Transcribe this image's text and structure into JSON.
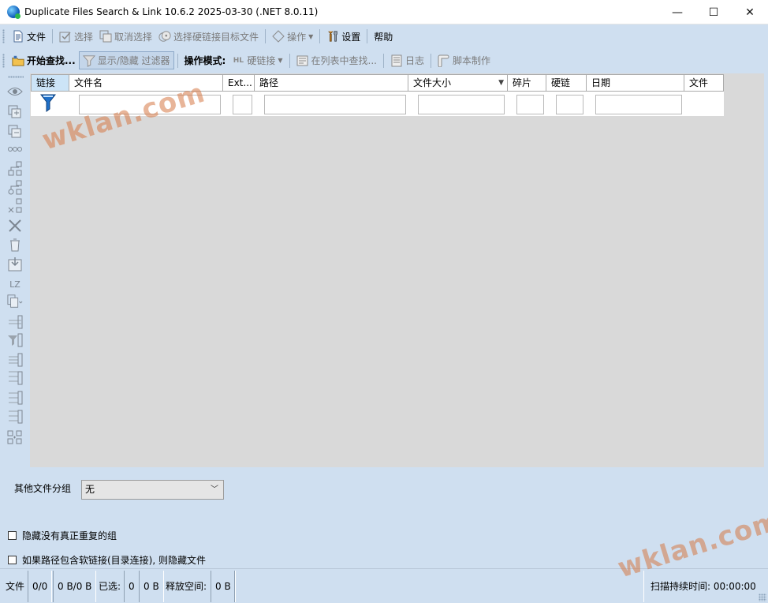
{
  "window": {
    "title": "Duplicate Files Search & Link 10.6.2 2025-03-30 (.NET 8.0.11)",
    "minimize": "—",
    "maximize": "☐",
    "close": "✕"
  },
  "menu_toolbar": {
    "file": "文件",
    "select": "选择",
    "deselect": "取消选择",
    "select_hardlink_target": "选择硬链接目标文件",
    "operations": "操作",
    "settings": "设置",
    "help": "帮助"
  },
  "action_toolbar": {
    "start_search": "开始查找...",
    "toggle_filter": "显示/隐藏 过滤器",
    "mode_label": "操作模式:",
    "hardlink": "硬链接",
    "find_in_list": "在列表中查找...",
    "log": "日志",
    "script": "脚本制作"
  },
  "grid": {
    "columns": [
      "链接",
      "文件名",
      "Ext...",
      "路径",
      "文件大小",
      "碎片",
      "硬链",
      "日期",
      "文件"
    ],
    "sorted_column": "文件大小",
    "selected_column": "链接"
  },
  "options": {
    "group_label": "其他文件分组",
    "group_value": "无",
    "hide_groups": "隐藏没有真正重复的组",
    "hide_softlink": "如果路径包含软链接(目录连接), 则隐藏文件"
  },
  "status": {
    "files_label": "文件",
    "files_count": "0/0",
    "files_size": "0 B/0 B",
    "selected_label": "已选:",
    "selected_count": "0",
    "selected_size": "0 B",
    "free_label": "释放空间:",
    "free_value": "0 B",
    "scan_time_label": "扫描持续时间:",
    "scan_time": "00:00:00"
  },
  "watermarks": [
    "wklan.com",
    "wklan.com"
  ],
  "colors": {
    "background": "#cfdff0",
    "grid_bg": "#d9d9d9",
    "selected_header": "#cce4f7",
    "filter_icon": "#1e6fc8"
  },
  "icons": {
    "side": [
      "eye-icon",
      "add-group-icon",
      "remove-group-icon",
      "link-icon",
      "select-tree-icon",
      "select-tree-2-icon",
      "select-tree-3-icon",
      "delete-icon",
      "recycle-icon",
      "move-icon",
      "lz-icon",
      "copy-icon",
      "bar-1-icon",
      "filter-bar-icon",
      "bar-2-icon",
      "bar-3-icon",
      "bar-4-icon",
      "bar-5-icon",
      "split-icon"
    ]
  }
}
